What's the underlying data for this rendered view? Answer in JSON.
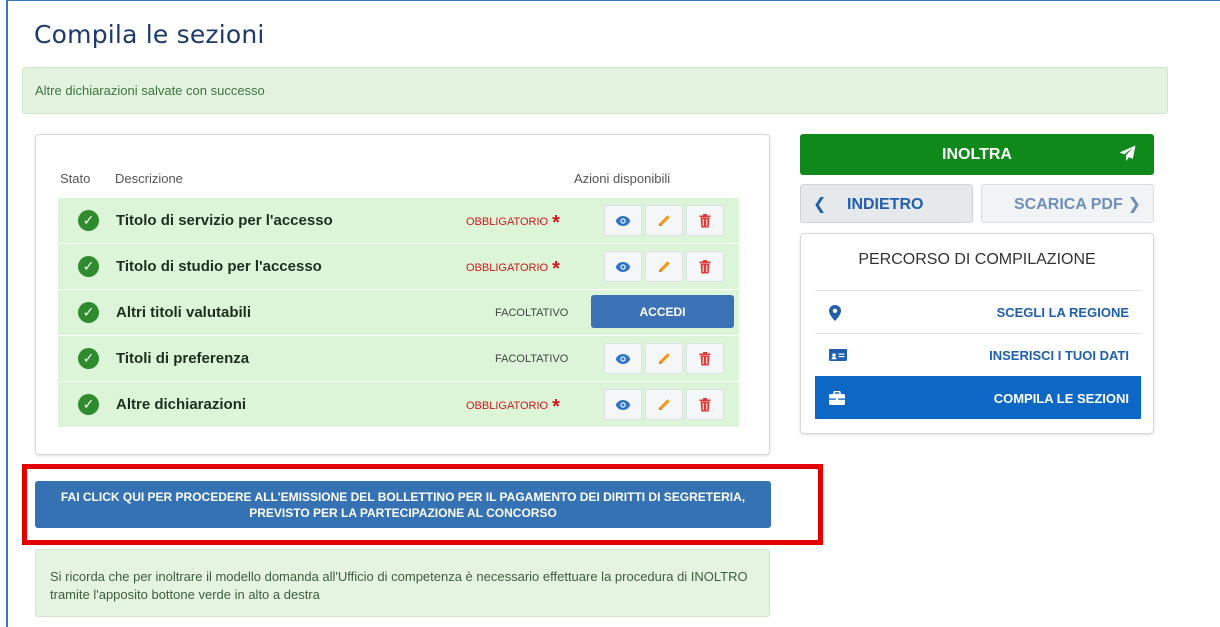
{
  "page": {
    "title": "Compila le sezioni"
  },
  "alerts": {
    "success": "Altre dichiarazioni salvate con successo",
    "info": "Si ricorda che per inoltrare il modello domanda all'Ufficio di competenza è necessario effettuare la procedura di INOLTRO tramite l'apposito bottone verde in alto a destra"
  },
  "table": {
    "headers": {
      "stato": "Stato",
      "descrizione": "Descrizione",
      "azioni": "Azioni disponibili"
    },
    "rows": [
      {
        "descrizione": "Titolo di servizio per l'accesso",
        "requirement": "OBBLIGATORIO",
        "star": "*"
      },
      {
        "descrizione": "Titolo di studio per l'accesso",
        "requirement": "OBBLIGATORIO",
        "star": "*"
      },
      {
        "descrizione": "Altri titoli valutabili",
        "requirement": "FACOLTATIVO",
        "action": "ACCEDI"
      },
      {
        "descrizione": "Titoli di preferenza",
        "requirement": "FACOLTATIVO"
      },
      {
        "descrizione": "Altre dichiarazioni",
        "requirement": "OBBLIGATORIO",
        "star": "*"
      }
    ]
  },
  "bollettino_button": "FAI CLICK QUI PER PROCEDERE ALL'EMISSIONE DEL BOLLETTINO PER IL PAGAMENTO DEI DIRITTI DI SEGRETERIA, PREVISTO PER LA PARTECIPAZIONE AL CONCORSO",
  "actions": {
    "inoltra": "INOLTRA",
    "indietro": "INDIETRO",
    "scarica_pdf": "SCARICA PDF"
  },
  "percorso": {
    "title": "PERCORSO DI COMPILAZIONE",
    "steps": [
      {
        "label": "SCEGLI LA REGIONE",
        "icon": "map-marker-icon"
      },
      {
        "label": "INSERISCI I TUOI DATI",
        "icon": "id-card-icon"
      },
      {
        "label": "COMPILA LE SEZIONI",
        "icon": "briefcase-icon",
        "active": true
      }
    ]
  },
  "colors": {
    "primary": "#3472b4",
    "success": "#0f8a1a",
    "required": "#d11a1a",
    "row_bg": "#dcf5d8",
    "highlight_box": "#e30000"
  }
}
